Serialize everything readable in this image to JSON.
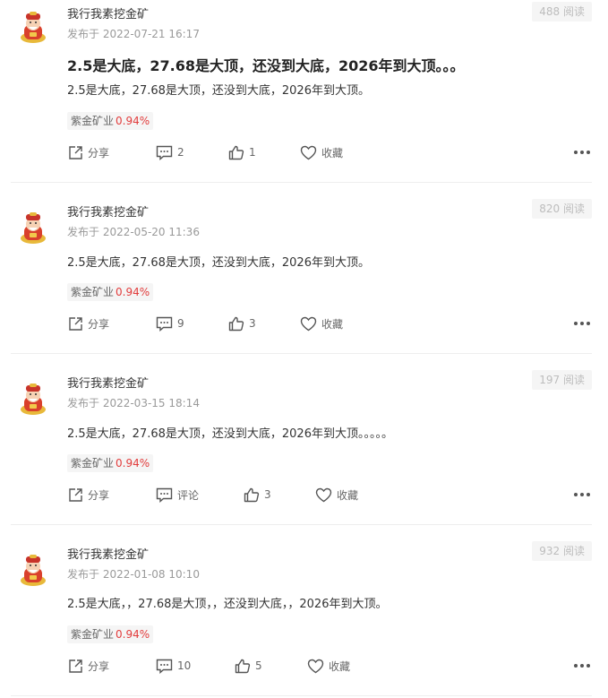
{
  "posts": [
    {
      "author": "我行我素挖金矿",
      "published": "发布于 2022-07-21 16:17",
      "views": "488 阅读",
      "title": "2.5是大底，27.68是大顶，还没到大底，2026年到大顶。。。",
      "body": "2.5是大底，27.68是大顶，还没到大底，2026年到大顶。",
      "stock_name": "紫金矿业",
      "stock_change": "0.94%",
      "share_label": "分享",
      "comment_label": "2",
      "like_label": "1",
      "favorite_label": "收藏"
    },
    {
      "author": "我行我素挖金矿",
      "published": "发布于 2022-05-20 11:36",
      "views": "820 阅读",
      "body": "2.5是大底，27.68是大顶，还没到大底，2026年到大顶。",
      "stock_name": "紫金矿业",
      "stock_change": "0.94%",
      "share_label": "分享",
      "comment_label": "9",
      "like_label": "3",
      "favorite_label": "收藏"
    },
    {
      "author": "我行我素挖金矿",
      "published": "发布于 2022-03-15 18:14",
      "views": "197 阅读",
      "body": "2.5是大底，27.68是大顶，还没到大底，2026年到大顶。。。。。",
      "stock_name": "紫金矿业",
      "stock_change": "0.94%",
      "share_label": "分享",
      "comment_label": "评论",
      "like_label": "3",
      "favorite_label": "收藏"
    },
    {
      "author": "我行我素挖金矿",
      "published": "发布于 2022-01-08 10:10",
      "views": "932 阅读",
      "body": "2.5是大底，，27.68是大顶，，还没到大底，，2026年到大顶。",
      "stock_name": "紫金矿业",
      "stock_change": "0.94%",
      "share_label": "分享",
      "comment_label": "10",
      "like_label": "5",
      "favorite_label": "收藏"
    }
  ],
  "colors": {
    "stock_up": "#e23c3c",
    "muted": "#9a9a9a",
    "divider": "#eeeeee"
  },
  "icons": [
    "avatar-god-of-wealth",
    "share-icon",
    "comment-icon",
    "like-icon",
    "favorite-heart-icon",
    "more-dots-icon"
  ]
}
